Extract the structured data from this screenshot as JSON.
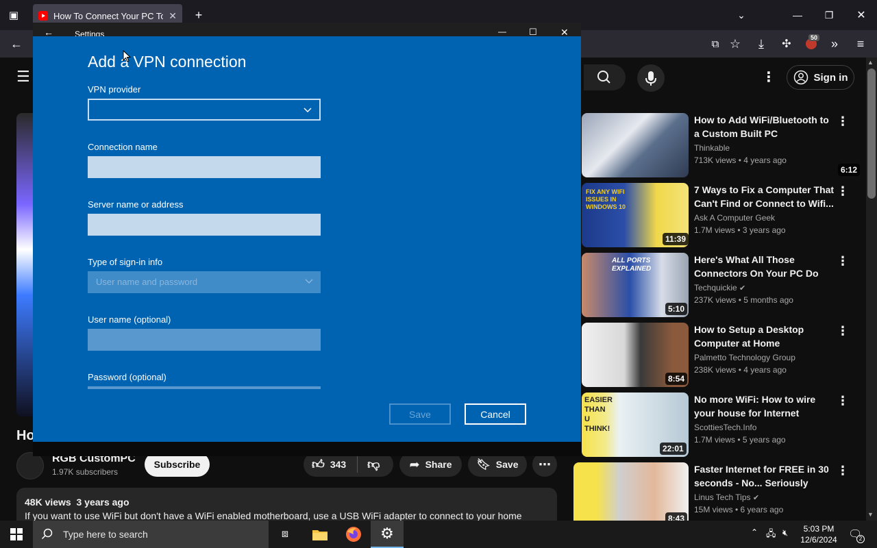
{
  "browser": {
    "tab_title": "How To Connect Your PC To Th",
    "new_tab": "+",
    "extension_badge": "50"
  },
  "youtube": {
    "sign_in": "Sign in",
    "video_title_fragment": "Ho",
    "channel": {
      "name": "RGB CustomPC",
      "subscribers": "1.97K subscribers",
      "subscribe_label": "Subscribe"
    },
    "actions": {
      "likes": "343",
      "share": "Share",
      "save": "Save"
    },
    "description": {
      "stats": "48K views  3 years ago",
      "text": "If you want to use WiFi but don't have a WiFi enabled motherboard, use a USB WiFi adapter to connect to your home"
    },
    "recommendations": [
      {
        "title": "How to Add WiFi/Bluetooth to a Custom Built PC",
        "channel": "Thinkable",
        "verified": false,
        "meta": "713K views • 4 years ago",
        "duration": "6:12"
      },
      {
        "title": "7 Ways to Fix a Computer That Can't Find or Connect to Wifi...",
        "channel": "Ask A Computer Geek",
        "verified": false,
        "meta": "1.7M views • 3 years ago",
        "duration": "11:39",
        "thumb_text": "FIX ANY WIFI ISSUES IN WINDOWS 10"
      },
      {
        "title": "Here's What All Those Connectors On Your PC Do",
        "channel": "Techquickie",
        "verified": true,
        "meta": "237K views • 5 months ago",
        "duration": "5:10",
        "thumb_text": "ALL PORTS EXPLAINED"
      },
      {
        "title": "How to Setup a Desktop Computer at Home",
        "channel": "Palmetto Technology Group",
        "verified": false,
        "meta": "238K views • 4 years ago",
        "duration": "8:54"
      },
      {
        "title": "No more WiFi: How to wire your house for Internet",
        "channel": "ScottiesTech.Info",
        "verified": false,
        "meta": "1.7M views • 5 years ago",
        "duration": "22:01",
        "thumb_text": "EASIER THAN U THINK!"
      },
      {
        "title": "Faster Internet for FREE in 30 seconds - No... Seriously",
        "channel": "Linus Tech Tips",
        "verified": true,
        "meta": "15M views • 6 years ago",
        "duration": "8:43"
      }
    ]
  },
  "settings": {
    "window_title": "Settings",
    "heading": "Add a VPN connection",
    "vpn_provider_label": "VPN provider",
    "vpn_provider_value": "",
    "connection_name_label": "Connection name",
    "connection_name_value": "",
    "server_label": "Server name or address",
    "server_value": "",
    "signin_type_label": "Type of sign-in info",
    "signin_type_value": "User name and password",
    "username_label": "User name (optional)",
    "username_value": "",
    "password_label": "Password (optional)",
    "save_label": "Save",
    "cancel_label": "Cancel"
  },
  "taskbar": {
    "search_placeholder": "Type here to search",
    "time": "5:03 PM",
    "date": "12/6/2024",
    "notification_count": "2"
  },
  "colors": {
    "dialog_bg": "#0063b1",
    "field_bg": "#c5d9ec",
    "yt_bg": "#0f0f0f",
    "taskbar": "#1a1a1a"
  }
}
